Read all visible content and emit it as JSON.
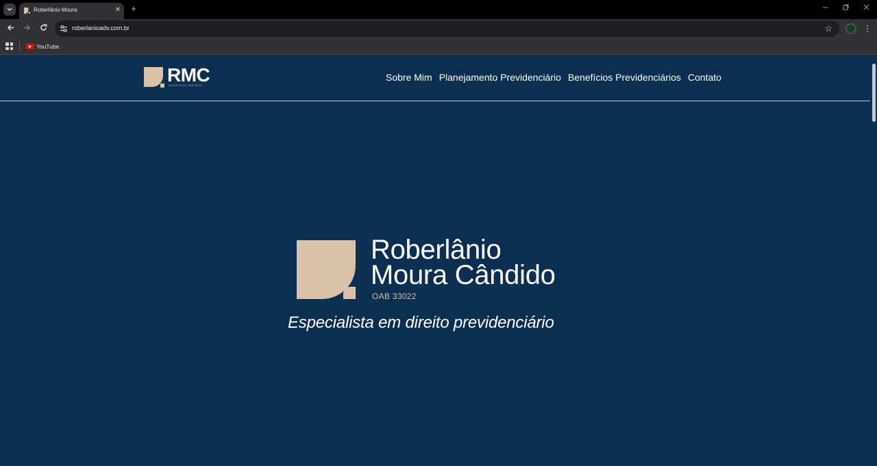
{
  "browser": {
    "tab_title": "Roberlânio Moura",
    "tab_close": "✕",
    "new_tab": "+",
    "url": "roberlanioadv.com.br",
    "bookmarks": [
      {
        "label": "YouTube",
        "icon": "youtube-icon"
      }
    ],
    "icons": [
      "tab-search-icon",
      "back-arrow-icon",
      "forward-arrow-icon",
      "reload-icon",
      "site-info-icon",
      "bookmark-star-icon",
      "extension-icon",
      "menu-dots-icon",
      "apps-grid-icon",
      "minimize-icon",
      "maximize-icon",
      "close-window-icon"
    ]
  },
  "site": {
    "logo": {
      "text": "RMC",
      "subtitle": "ADVOCACIA | OAB 33022"
    },
    "nav": [
      {
        "label": "Sobre Mim"
      },
      {
        "label": "Planejamento Previdenciário"
      },
      {
        "label": "Benefícios Previdenciários"
      },
      {
        "label": "Contato"
      }
    ],
    "hero": {
      "name_line1": "Roberlânio",
      "name_line2": "Moura Cândido",
      "oab": "OAB 33022",
      "tagline": "Especialista em direito previdenciário"
    },
    "colors": {
      "background": "#0c2e50",
      "accent_beige": "#d9c2a8",
      "text": "#ffffff"
    }
  }
}
